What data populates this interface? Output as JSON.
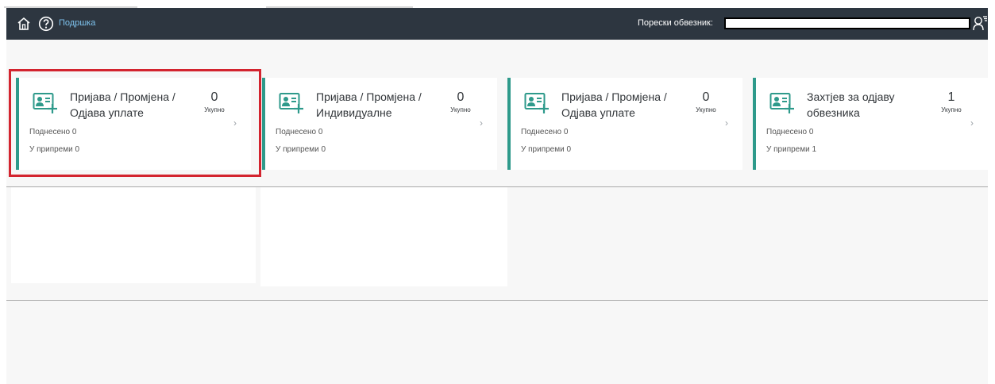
{
  "shellbar": {
    "help_label": "Подршка",
    "taxpayer_label": "Порески обвезник:",
    "taxpayer_value": "",
    "icons": [
      "home-icon",
      "help-icon",
      "user-menu-icon"
    ]
  },
  "tiles": [
    {
      "title": "Пријава / Промјена / Одјава уплате",
      "count": "0",
      "count_label": "Укупно",
      "submitted": "Поднесено 0",
      "in_preparation": "У припреми 0",
      "icon": "add-person-card-icon",
      "selected": true
    },
    {
      "title": "Пријава / Промјена / Индивидуалне",
      "count": "0",
      "count_label": "Укупно",
      "submitted": "Поднесено 0",
      "in_preparation": "У припреми 0",
      "icon": "add-person-card-icon",
      "selected": false
    },
    {
      "title": "Пријава / Промјена / Одјава уплате",
      "count": "0",
      "count_label": "Укупно",
      "submitted": "Поднесено 0",
      "in_preparation": "У припреми 0",
      "icon": "add-person-card-icon",
      "selected": false
    },
    {
      "title": "Захтјев за одјаву обвезника",
      "count": "1",
      "count_label": "Укупно",
      "submitted": "Поднесено 0",
      "in_preparation": "У припреми 1",
      "icon": "add-person-card-icon",
      "selected": false
    }
  ],
  "colors": {
    "shellbar": "#2d3640",
    "accent": "#2e9a8b",
    "highlight": "#d3242f",
    "link": "#7ec3ee"
  }
}
